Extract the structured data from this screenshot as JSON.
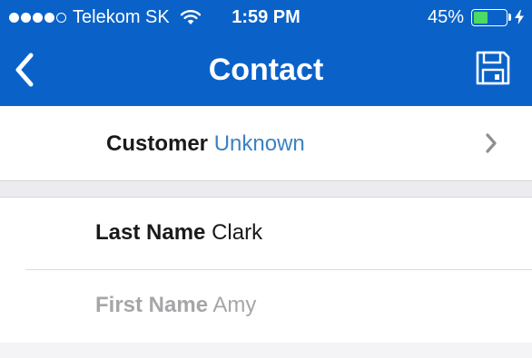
{
  "status_bar": {
    "signal_dots_filled": 4,
    "signal_dots_total": 5,
    "carrier": "Telekom SK",
    "time": "1:59 PM",
    "battery_percent_label": "45%",
    "battery_level": 0.45,
    "charging": true,
    "icons": [
      "signal-dots-icon",
      "wifi-icon",
      "battery-icon",
      "charging-bolt-icon"
    ]
  },
  "nav": {
    "title": "Contact",
    "back_icon": "chevron-left-icon",
    "save_icon": "floppy-disk-icon"
  },
  "customer": {
    "label": "Customer",
    "value": "Unknown",
    "disclosure_icon": "chevron-right-icon"
  },
  "fields": {
    "last_name": {
      "label": "Last Name",
      "value": "Clark"
    },
    "first_name": {
      "label": "First Name",
      "value": "Amy"
    }
  },
  "colors": {
    "header_blue": "#0a62c9",
    "link_blue": "#3b82c4",
    "battery_green": "#4cd964",
    "muted_gray": "#a6a6aa",
    "section_gray": "#ebebf0"
  }
}
